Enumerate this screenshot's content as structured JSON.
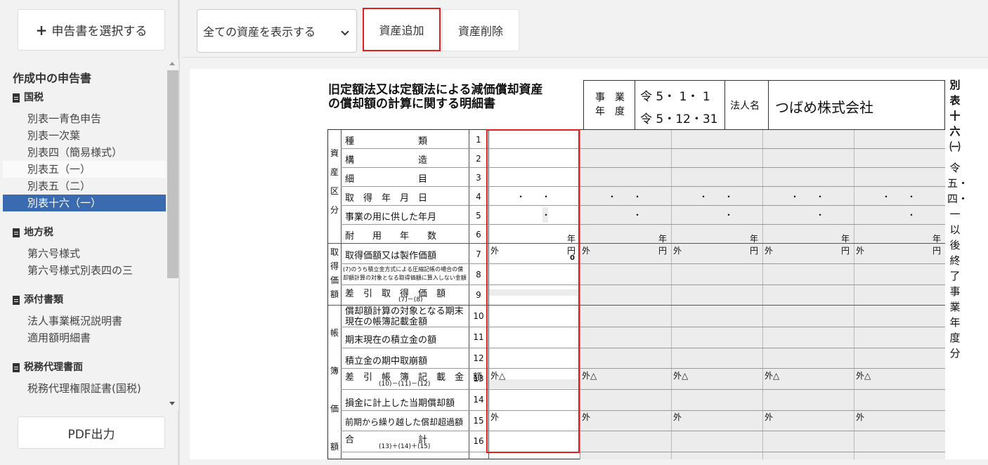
{
  "sidebar": {
    "select_button": "申告書を選択する",
    "section_title": "作成中の申告書",
    "groups": [
      {
        "label": "国税",
        "items": [
          "別表一青色申告",
          "別表一次葉",
          "別表四（簡易様式）",
          "別表五（一）",
          "別表五（二）",
          "別表十六（一）"
        ]
      },
      {
        "label": "地方税",
        "items": [
          "第六号様式",
          "第六号様式別表四の三"
        ]
      },
      {
        "label": "添付書類",
        "items": [
          "法人事業概況説明書",
          "適用額明細書"
        ]
      },
      {
        "label": "税務代理書面",
        "items": [
          "税務代理権限証書(国税)"
        ]
      }
    ],
    "pdf_button": "PDF出力"
  },
  "toolbar": {
    "filter_selected": "全ての資産を表示する",
    "add_button": "資産追加",
    "delete_button": "資産削除"
  },
  "form": {
    "title_line1": "旧定額法又は定額法による減価償却資産",
    "title_line2": "の償却額の計算に関する明細書",
    "year_label1": "事　業",
    "year_label2": "年　度",
    "year_from": "令 5・ 1・ 1",
    "year_to": "令 5・12・31",
    "corp_label": "法人名",
    "corp_name": "つばめ株式会社",
    "side_label": "別表十六㈠",
    "side_label2": "令五・四・一以後終了事業年度分",
    "groups": [
      "資産区分",
      "取得価額",
      "帳簿価額"
    ],
    "rows": [
      {
        "no": "1",
        "label": "種　　　　　　　類"
      },
      {
        "no": "2",
        "label": "構　　　　　　　造"
      },
      {
        "no": "3",
        "label": "細　　　　　　　目"
      },
      {
        "no": "4",
        "label": "取　得　年　月　日"
      },
      {
        "no": "5",
        "label": "事業の用に供した年月"
      },
      {
        "no": "6",
        "label": "耐　　用　　年　　数"
      },
      {
        "no": "7",
        "label": "取得価額又は製作価額"
      },
      {
        "no": "8",
        "label": "(7)のうち積立金方式による圧縮記帳の場合の償却額計算の対象となる取得価額に算入しない金額"
      },
      {
        "no": "9",
        "label": "差　引　取　得　価　額",
        "sub": "(7)－(8)"
      },
      {
        "no": "10",
        "label": "償却額計算の対象となる期末現在の帳簿記載金額"
      },
      {
        "no": "11",
        "label": "期末現在の積立金の額"
      },
      {
        "no": "12",
        "label": "積立金の期中取崩額"
      },
      {
        "no": "13",
        "label": "差　引　帳　簿　記　載　金　額",
        "sub": "(10)－(11)－(12)"
      },
      {
        "no": "14",
        "label": "損金に計上した当期償却額"
      },
      {
        "no": "15",
        "label": "前期から繰り越した償却超過額"
      },
      {
        "no": "16",
        "label": "合　　　　　　　計",
        "sub": "(13)＋(14)＋(15)"
      }
    ],
    "cell_text": {
      "year": "年",
      "outside": "外",
      "yen": "円",
      "outside_triangle": "外△",
      "dots": "・　　・",
      "dot": "・",
      "value_zero": "0"
    }
  }
}
